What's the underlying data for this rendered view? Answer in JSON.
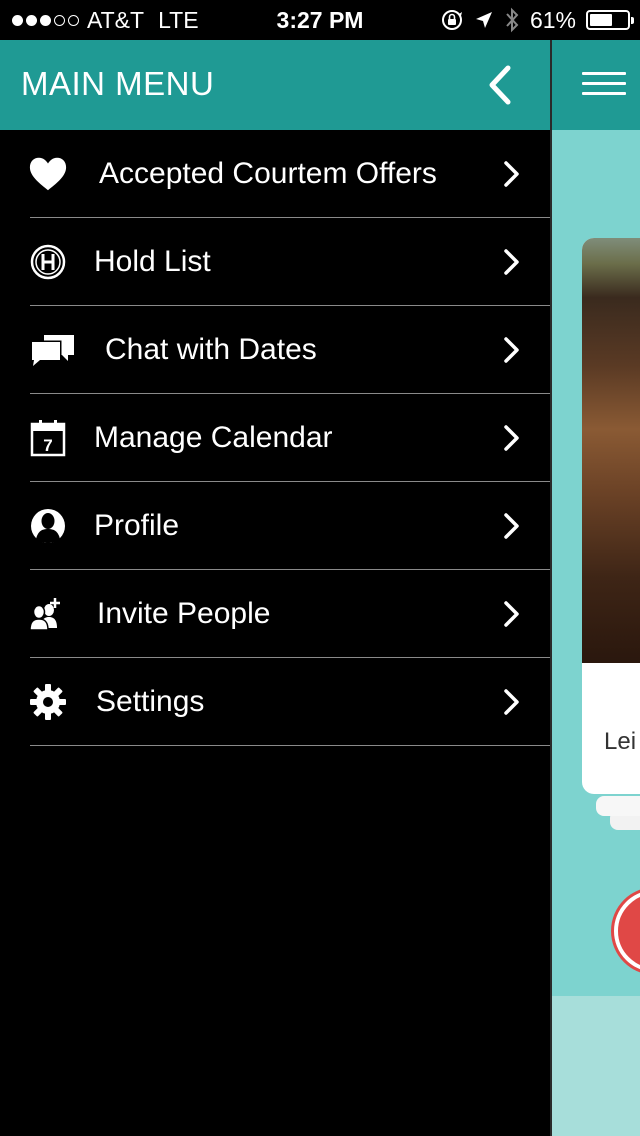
{
  "status_bar": {
    "carrier": "AT&T",
    "network": "LTE",
    "time": "3:27 PM",
    "battery_percent": "61%",
    "battery_level": 0.61,
    "signal_bars": 3,
    "signal_total": 5
  },
  "menu": {
    "title": "MAIN MENU",
    "header_color": "#1f9a94",
    "items": [
      {
        "label": "Accepted Courtem Offers",
        "icon": "heart-icon"
      },
      {
        "label": "Hold List",
        "icon": "hold-h-icon"
      },
      {
        "label": "Chat with Dates",
        "icon": "chat-bubbles-icon"
      },
      {
        "label": "Manage Calendar",
        "icon": "calendar-icon",
        "icon_text": "7"
      },
      {
        "label": "Profile",
        "icon": "profile-icon"
      },
      {
        "label": "Invite People",
        "icon": "invite-people-icon"
      },
      {
        "label": "Settings",
        "icon": "gear-icon"
      }
    ]
  },
  "main_peek": {
    "background_color": "#7dd3cf",
    "card_name_partial": "Lei"
  }
}
